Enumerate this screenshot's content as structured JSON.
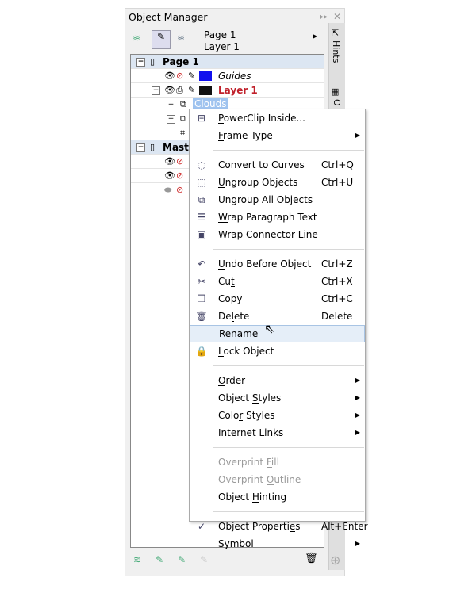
{
  "panel": {
    "title": "Object Manager",
    "current_page": "Page 1",
    "current_layer": "Layer 1",
    "docker_tabs": [
      "Hints",
      "O"
    ]
  },
  "tree": {
    "page1": "Page 1",
    "guides": "Guides",
    "layer1": "Layer 1",
    "clouds": "Clouds",
    "master": "Maste",
    "colors": {
      "guides": "#1010ee",
      "layer1": "#111111",
      "layer1_text": "#c0202a",
      "selection": "#9fc3ef"
    }
  },
  "menu": {
    "items": [
      {
        "label": "PowerClip Inside...",
        "m": 0,
        "icon": "powerclip-icon",
        "glyph": "⊟"
      },
      {
        "label": "Frame Type",
        "m": 0,
        "sub": true
      },
      {
        "sep": true
      },
      {
        "label": "Convert to Curves",
        "m": 4,
        "sc": "Ctrl+Q",
        "icon": "convert-curves-icon",
        "glyph": "◌"
      },
      {
        "label": "Ungroup Objects",
        "m": 0,
        "sc": "Ctrl+U",
        "icon": "ungroup-icon",
        "glyph": "⬚"
      },
      {
        "label": "Ungroup All Objects",
        "m": 1,
        "icon": "ungroup-all-icon",
        "glyph": "⧉"
      },
      {
        "label": "Wrap Paragraph Text",
        "m": 0,
        "icon": "wrap-text-icon",
        "glyph": "☰"
      },
      {
        "label": "Wrap Connector Line",
        "m": -1,
        "icon": "wrap-connector-icon",
        "glyph": "▣"
      },
      {
        "sep": true
      },
      {
        "label": "Undo Before Object",
        "m": 0,
        "sc": "Ctrl+Z",
        "icon": "undo-icon",
        "glyph": "↶"
      },
      {
        "label": "Cut",
        "m": 2,
        "sc": "Ctrl+X",
        "icon": "scissors-icon",
        "glyph": "✂"
      },
      {
        "label": "Copy",
        "m": 0,
        "sc": "Ctrl+C",
        "icon": "copy-icon",
        "glyph": "❐"
      },
      {
        "label": "Delete",
        "m": 2,
        "sc": "Delete",
        "icon": "trash-icon",
        "glyph": "🗑"
      },
      {
        "label": "Rename",
        "m": -1,
        "hl": true
      },
      {
        "label": "Lock Object",
        "m": 0,
        "icon": "lock-icon",
        "glyph": "🔒"
      },
      {
        "sep": true
      },
      {
        "label": "Order",
        "m": 0,
        "sub": true
      },
      {
        "label": "Object Styles",
        "m": 7,
        "sub": true
      },
      {
        "label": "Color Styles",
        "m": 4,
        "sub": true
      },
      {
        "label": "Internet Links",
        "m": 1,
        "sub": true
      },
      {
        "sep": true
      },
      {
        "label": "Overprint Fill",
        "m": 10,
        "dis": true
      },
      {
        "label": "Overprint Outline",
        "m": 10,
        "dis": true
      },
      {
        "label": "Object Hinting",
        "m": 7
      },
      {
        "sep": true
      },
      {
        "label": "Object Properties",
        "m": 15,
        "sc": "Alt+Enter",
        "icon": "check-icon",
        "glyph": "✓"
      },
      {
        "label": "Symbol",
        "m": 1,
        "sub": true
      }
    ]
  }
}
